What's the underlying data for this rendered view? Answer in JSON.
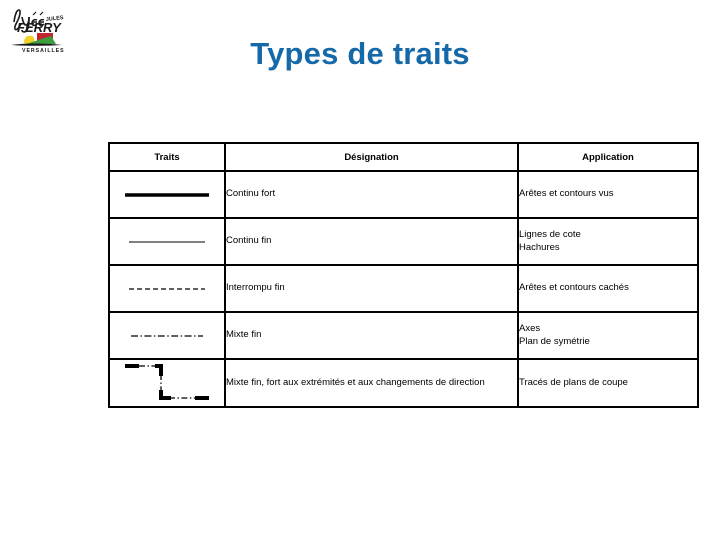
{
  "logo": {
    "name": "lycee-jules-ferry-versailles-logo",
    "line1": "lycée",
    "line2": "JULES",
    "line3": "FERRY",
    "line4": "VERSAILLES",
    "colors": {
      "red": "#c1272d",
      "yellow": "#f2d024",
      "green": "#3e9d3e",
      "dark": "#1a1a1a"
    }
  },
  "title": {
    "text": "Types de traits",
    "color": "#1569a9"
  },
  "table": {
    "headers": [
      "Traits",
      "Désignation",
      "Application"
    ],
    "rows": [
      {
        "sample": "continuous-thick-line",
        "designation": "Continu fort",
        "application": "Arêtes et contours vus"
      },
      {
        "sample": "continuous-thin-line",
        "designation": "Continu fin",
        "application": "Lignes de cote\nHachures"
      },
      {
        "sample": "dashed-thin-line",
        "designation": "Interrompu fin",
        "application": "Arêtes et contours cachés"
      },
      {
        "sample": "dash-dot-thin-line",
        "designation": "Mixte fin",
        "application": "Axes\nPlan de symétrie"
      },
      {
        "sample": "cutting-plane-line",
        "designation": "Mixte fin, fort aux extrémités et aux changements de direction",
        "application": "Tracés de plans de coupe"
      }
    ]
  }
}
